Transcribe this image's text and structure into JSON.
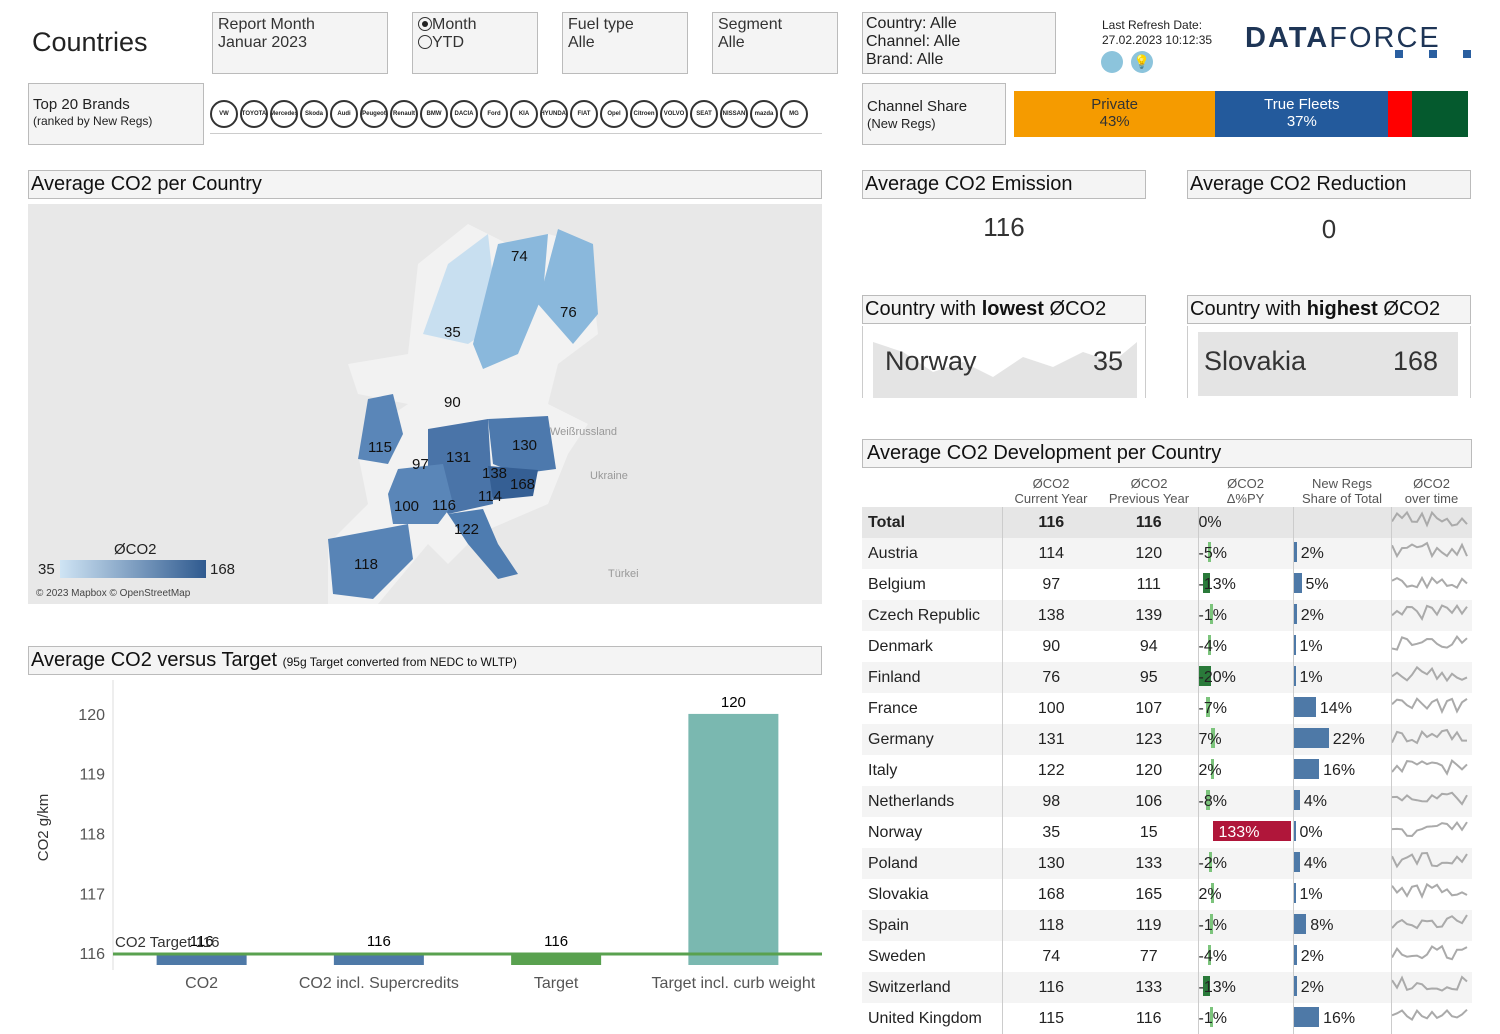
{
  "header": {
    "title": "Countries",
    "filters": [
      {
        "label": "Report Month",
        "value": "Januar 2023"
      },
      {
        "label": "Fuel type",
        "value": "Alle"
      },
      {
        "label": "Segment",
        "value": "Alle"
      }
    ],
    "period_options": [
      {
        "label": "Month",
        "selected": true
      },
      {
        "label": "YTD",
        "selected": false
      }
    ],
    "selection": [
      "Country: Alle",
      "Channel: Alle",
      "Brand: Alle"
    ],
    "refresh_label": "Last Refresh Date:",
    "refresh_date": "27.02.2023 10:12:35",
    "logo": "DATAFORCE"
  },
  "brands": {
    "title": "Top 20 Brands",
    "subtitle": "(ranked by New Regs)",
    "logos": [
      "VW",
      "TOYOTA",
      "Mercedes",
      "Skoda",
      "Audi",
      "Peugeot",
      "Renault",
      "BMW",
      "DACIA",
      "Ford",
      "KIA",
      "HYUNDAI",
      "FIAT",
      "Opel",
      "Citroen",
      "VOLVO",
      "SEAT",
      "NISSAN",
      "mazda",
      "MG"
    ]
  },
  "channel": {
    "title": "Channel Share",
    "subtitle": "(New Regs)",
    "segments": [
      {
        "label": "Private",
        "pct": "43%",
        "share": 43,
        "color": "#f59b00"
      },
      {
        "label": "True Fleets",
        "pct": "37%",
        "share": 37,
        "color": "#235a9c"
      },
      {
        "label": "",
        "pct": "",
        "share": 5,
        "color": "#ff0000"
      },
      {
        "label": "",
        "pct": "",
        "share": 12,
        "color": "#055a2e"
      }
    ]
  },
  "map": {
    "title": "Average CO2 per Country",
    "legend_title": "ØCO2",
    "legend_min": "35",
    "legend_max": "168",
    "attribution": "© 2023 Mapbox © OpenStreetMap",
    "places": [
      "Weißrussland",
      "Ukraine",
      "Türkei"
    ],
    "labels": [
      {
        "country": "Norway",
        "value": "35"
      },
      {
        "country": "Sweden",
        "value": "74"
      },
      {
        "country": "Finland",
        "value": "76"
      },
      {
        "country": "Denmark",
        "value": "90"
      },
      {
        "country": "United Kingdom",
        "value": "115"
      },
      {
        "country": "Belgium",
        "value": "97"
      },
      {
        "country": "Germany",
        "value": "131"
      },
      {
        "country": "Poland",
        "value": "130"
      },
      {
        "country": "Czech Republic",
        "value": "138"
      },
      {
        "country": "Slovakia",
        "value": "168"
      },
      {
        "country": "Austria",
        "value": "114"
      },
      {
        "country": "France",
        "value": "100"
      },
      {
        "country": "Switzerland",
        "value": "116"
      },
      {
        "country": "Italy",
        "value": "122"
      },
      {
        "country": "Spain",
        "value": "118"
      }
    ]
  },
  "kpis": {
    "avg_emission": {
      "title": "Average CO2 Emission",
      "value": "116"
    },
    "avg_reduction": {
      "title": "Average CO2 Reduction",
      "value": "0"
    },
    "lowest": {
      "title_pre": "Country with ",
      "title_bold": "lowest",
      "title_post": " ØCO2",
      "country": "Norway",
      "value": "35"
    },
    "highest": {
      "title_pre": "Country with ",
      "title_bold": "highest",
      "title_post": " ØCO2",
      "country": "Slovakia",
      "value": "168"
    }
  },
  "target": {
    "title": "Average CO2 versus Target",
    "subtitle": "(95g Target converted from NEDC to WLTP)",
    "target_line_label": "CO2 Target",
    "target_line_value": "116"
  },
  "chart_data": {
    "type": "bar",
    "title": "Average CO2 versus Target",
    "ylabel": "CO2 g/km",
    "ylim": [
      115.8,
      120.4
    ],
    "yticks": [
      "116",
      "117",
      "118",
      "119",
      "120"
    ],
    "categories": [
      "CO2",
      "CO2 incl. Supercredits",
      "Target",
      "Target incl. curb weight"
    ],
    "values": [
      116,
      116,
      116,
      120
    ],
    "labels": [
      "116",
      "116",
      "116",
      "120"
    ],
    "colors": [
      "#4e79a7",
      "#4e79a7",
      "#59a14f",
      "#7ab8b0"
    ],
    "reference_line": 116
  },
  "table": {
    "title": "Average CO2 Development per Country",
    "columns": [
      [
        "",
        ""
      ],
      [
        "ØCO2",
        "Current Year"
      ],
      [
        "ØCO2",
        "Previous Year"
      ],
      [
        "ØCO2",
        "Δ%PY"
      ],
      [
        "New Regs",
        "Share of Total"
      ],
      [
        "ØCO2",
        "over time"
      ]
    ],
    "total": {
      "name": "Total",
      "cy": "116",
      "py": "116",
      "delta": "0%",
      "share": ""
    },
    "rows": [
      {
        "name": "Austria",
        "cy": "114",
        "py": "120",
        "delta": "-5%",
        "d": -5,
        "share": "2%",
        "s": 2
      },
      {
        "name": "Belgium",
        "cy": "97",
        "py": "111",
        "delta": "-13%",
        "d": -13,
        "share": "5%",
        "s": 5
      },
      {
        "name": "Czech Republic",
        "cy": "138",
        "py": "139",
        "delta": "-1%",
        "d": -1,
        "share": "2%",
        "s": 2
      },
      {
        "name": "Denmark",
        "cy": "90",
        "py": "94",
        "delta": "-4%",
        "d": -4,
        "share": "1%",
        "s": 1
      },
      {
        "name": "Finland",
        "cy": "76",
        "py": "95",
        "delta": "-20%",
        "d": -20,
        "share": "1%",
        "s": 1
      },
      {
        "name": "France",
        "cy": "100",
        "py": "107",
        "delta": "-7%",
        "d": -7,
        "share": "14%",
        "s": 14
      },
      {
        "name": "Germany",
        "cy": "131",
        "py": "123",
        "delta": "7%",
        "d": 7,
        "share": "22%",
        "s": 22
      },
      {
        "name": "Italy",
        "cy": "122",
        "py": "120",
        "delta": "2%",
        "d": 2,
        "share": "16%",
        "s": 16
      },
      {
        "name": "Netherlands",
        "cy": "98",
        "py": "106",
        "delta": "-8%",
        "d": -8,
        "share": "4%",
        "s": 4
      },
      {
        "name": "Norway",
        "cy": "35",
        "py": "15",
        "delta": "133%",
        "d": 133,
        "share": "0%",
        "s": 0
      },
      {
        "name": "Poland",
        "cy": "130",
        "py": "133",
        "delta": "-2%",
        "d": -2,
        "share": "4%",
        "s": 4
      },
      {
        "name": "Slovakia",
        "cy": "168",
        "py": "165",
        "delta": "2%",
        "d": 2,
        "share": "1%",
        "s": 1
      },
      {
        "name": "Spain",
        "cy": "118",
        "py": "119",
        "delta": "-1%",
        "d": -1,
        "share": "8%",
        "s": 8
      },
      {
        "name": "Sweden",
        "cy": "74",
        "py": "77",
        "delta": "-4%",
        "d": -4,
        "share": "2%",
        "s": 2
      },
      {
        "name": "Switzerland",
        "cy": "116",
        "py": "133",
        "delta": "-13%",
        "d": -13,
        "share": "2%",
        "s": 2
      },
      {
        "name": "United Kingdom",
        "cy": "115",
        "py": "116",
        "delta": "-1%",
        "d": -1,
        "share": "16%",
        "s": 16
      }
    ]
  }
}
